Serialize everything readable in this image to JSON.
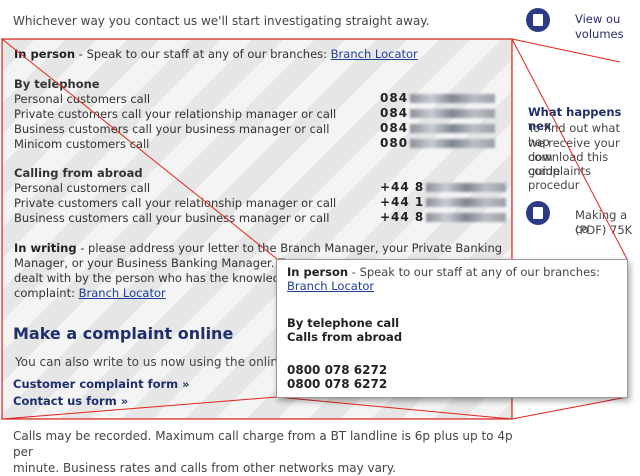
{
  "intro": "Whichever way you contact us we'll start investigating straight away.",
  "in_person": {
    "label": "In person",
    "text": " - Speak to our staff at any of our branches: ",
    "link": "Branch Locator"
  },
  "telephone": {
    "heading": "By telephone",
    "rows": [
      {
        "label": "Personal customers call",
        "prefix": "084"
      },
      {
        "label": "Private customers call your relationship manager or call",
        "prefix": "084"
      },
      {
        "label": "Business customers call your business manager or call",
        "prefix": "084"
      },
      {
        "label": "Minicom customers call",
        "prefix": "080"
      }
    ]
  },
  "abroad": {
    "heading": "Calling from abroad",
    "rows": [
      {
        "label": "Personal customers call",
        "prefix": "+44 8"
      },
      {
        "label": "Private customers call your relationship manager or call",
        "prefix": "+44 1"
      },
      {
        "label": "Business customers call your business manager or call",
        "prefix": "+44 8"
      }
    ]
  },
  "writing": {
    "label": "In writing",
    "line1": " - please address your letter to the Branch Manager, your Private Banking",
    "line2": "Manager, or your Business Banking Manager. T",
    "line3": "dealt with by the person who has the knowledg",
    "line4": "complaint: ",
    "link": "Branch Locator"
  },
  "online": {
    "heading": "Make a complaint online",
    "text": "You can also write to us now using the online f",
    "form_link": "Customer complaint form »",
    "contact_link": "Contact us form »"
  },
  "footer": {
    "line1": "Calls may be recorded. Maximum call charge from a BT landline is 6p plus up to 4p per",
    "line2": "minute. Business rates and calls from other networks may vary."
  },
  "sidebar": {
    "item1_line1": "View ou",
    "item1_line2": "volumes",
    "what_happens": "What happens nex",
    "para_lines": [
      "To find out what hap",
      "we receive your com",
      "download this guide",
      "complaints procedur"
    ],
    "item2_line1": "Making a co",
    "item2_line2": "(PDF) 75K"
  },
  "zoom": {
    "label": "In person",
    "text": " - Speak to our staff at any of our branches:",
    "link": "Branch Locator",
    "line1": "By telephone call",
    "line2": "Calls from abroad",
    "phone1": "0800 078 6272",
    "phone2": "0800 078 6272"
  }
}
